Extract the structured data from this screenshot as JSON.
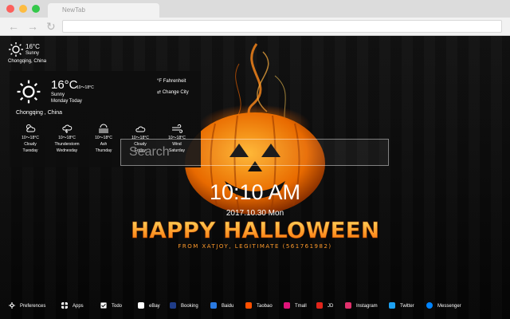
{
  "browser": {
    "tab_title": "NewTab",
    "back_glyph": "←",
    "forward_glyph": "→",
    "reload_glyph": "↻"
  },
  "weather_small": {
    "temp": "16°C",
    "condition": "Sunny",
    "city": "Chongqing,  China",
    "icon": "sun-icon"
  },
  "weather_panel": {
    "temp": "16°C",
    "range": "10～18°C",
    "condition": "Sunny",
    "day": "Monday Today",
    "city": "Chongqing , China",
    "fahrenheit_label": "Fahrenheit",
    "change_city_label": "Change City",
    "forecast": [
      {
        "range": "10～18°C",
        "condition": "Cloudy",
        "day": "Tuesday",
        "icon": "cloud-sun-icon"
      },
      {
        "range": "10～18°C",
        "condition": "Thunderstorm",
        "day": "Wednesday",
        "icon": "thunderstorm-icon"
      },
      {
        "range": "10～18°C",
        "condition": "Ash",
        "day": "Thursday",
        "icon": "haze-icon"
      },
      {
        "range": "10～18°C",
        "condition": "Cloudy",
        "day": "Friday",
        "icon": "cloud-icon"
      },
      {
        "range": "10～18°C",
        "condition": "Wind",
        "day": "Saturday",
        "icon": "wind-icon"
      }
    ]
  },
  "search": {
    "placeholder": "Search"
  },
  "clock": {
    "time": "10:10 AM",
    "date": "2017.10.30 Mon"
  },
  "wallpaper": {
    "headline": "HAPPY HALLOWEEN",
    "credit": "FROM XATJOY, LEGITIMATE (561761982)"
  },
  "bottom_bar": [
    {
      "label": "Preferences",
      "icon": "gear-icon",
      "color": "#ffffff"
    },
    {
      "label": "Apps",
      "icon": "apps-grid-icon",
      "color": "#ffffff"
    },
    {
      "label": "Todo",
      "icon": "checkbox-icon",
      "color": "#ffffff"
    },
    {
      "label": "eBay",
      "icon": "ebay-icon",
      "color": "#ffffff"
    },
    {
      "label": "Booking",
      "icon": "booking-icon",
      "color": "#1f3c88"
    },
    {
      "label": "Baidu",
      "icon": "baidu-icon",
      "color": "#2a7ae2"
    },
    {
      "label": "Taobao",
      "icon": "taobao-icon",
      "color": "#ff5000"
    },
    {
      "label": "Tmall",
      "icon": "tmall-icon",
      "color": "#e0147a"
    },
    {
      "label": "JD",
      "icon": "jd-icon",
      "color": "#e1251b"
    },
    {
      "label": "Instagram",
      "icon": "instagram-icon",
      "color": "#e1306c"
    },
    {
      "label": "Twitter",
      "icon": "twitter-icon",
      "color": "#1da1f2"
    },
    {
      "label": "Messenger",
      "icon": "messenger-icon",
      "color": "#0084ff"
    }
  ]
}
